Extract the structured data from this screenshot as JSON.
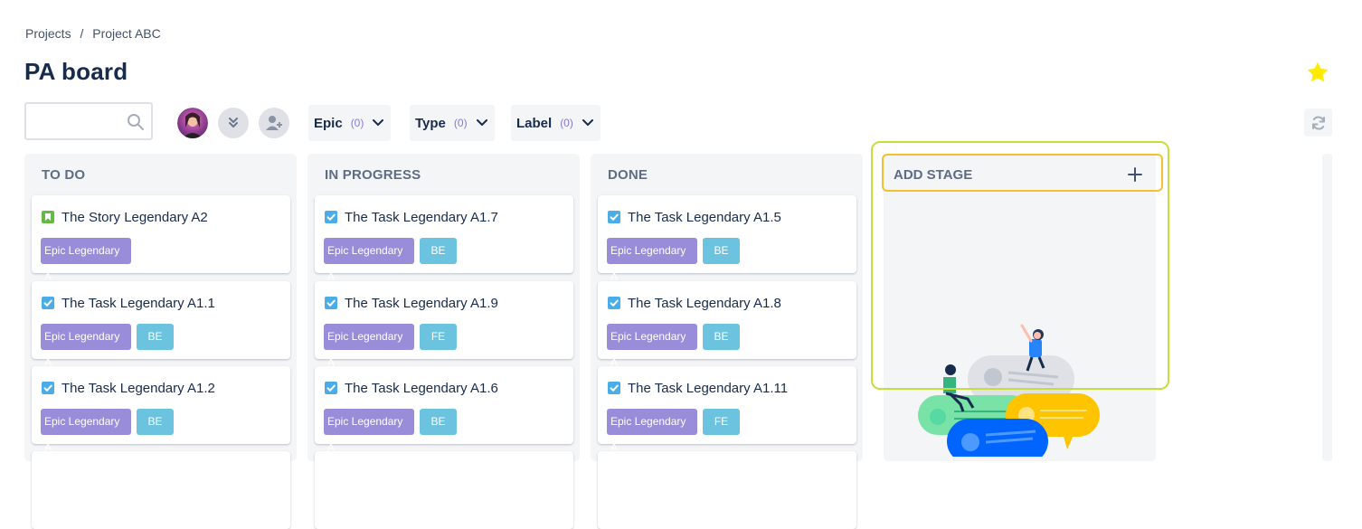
{
  "breadcrumb": {
    "projects": "Projects",
    "sep": "/",
    "project": "Project ABC"
  },
  "page_title": "PA board",
  "search": {
    "placeholder": ""
  },
  "filters": [
    {
      "label": "Epic",
      "count": "(0)"
    },
    {
      "label": "Type",
      "count": "(0)"
    },
    {
      "label": "Label",
      "count": "(0)"
    }
  ],
  "colors": {
    "epic_tag": "#998dd9",
    "label_tag": "#6cc3e0",
    "story_icon": "#65ba43",
    "task_icon": "#4bade8",
    "star": "#ffeb00",
    "highlight_outer": "#c6de3d",
    "highlight_inner": "#f5c02e"
  },
  "columns": [
    {
      "title": "TO DO",
      "cards": [
        {
          "type": "story-icon",
          "summary": "The Story Legendary A2",
          "epic": "Epic Legendary A",
          "label": ""
        },
        {
          "type": "task-icon",
          "summary": "The Task Legendary A1.1",
          "epic": "Epic Legendary A",
          "label": "BE"
        },
        {
          "type": "task-icon",
          "summary": "The Task Legendary A1.2",
          "epic": "Epic Legendary A",
          "label": "BE"
        }
      ]
    },
    {
      "title": "IN PROGRESS",
      "cards": [
        {
          "type": "task-icon",
          "summary": "The Task Legendary A1.7",
          "epic": "Epic Legendary A",
          "label": "BE"
        },
        {
          "type": "task-icon",
          "summary": "The Task Legendary A1.9",
          "epic": "Epic Legendary A",
          "label": "FE"
        },
        {
          "type": "task-icon",
          "summary": "The Task Legendary A1.6",
          "epic": "Epic Legendary A",
          "label": "BE"
        }
      ]
    },
    {
      "title": "DONE",
      "cards": [
        {
          "type": "task-icon",
          "summary": "The Task Legendary A1.5",
          "epic": "Epic Legendary A",
          "label": "BE"
        },
        {
          "type": "task-icon",
          "summary": "The Task Legendary A1.8",
          "epic": "Epic Legendary A",
          "label": "BE"
        },
        {
          "type": "task-icon",
          "summary": "The Task Legendary A1.11",
          "epic": "Epic Legendary A",
          "label": "FE"
        }
      ]
    }
  ],
  "add_stage": {
    "label": "ADD STAGE",
    "icon": "plus-icon"
  }
}
